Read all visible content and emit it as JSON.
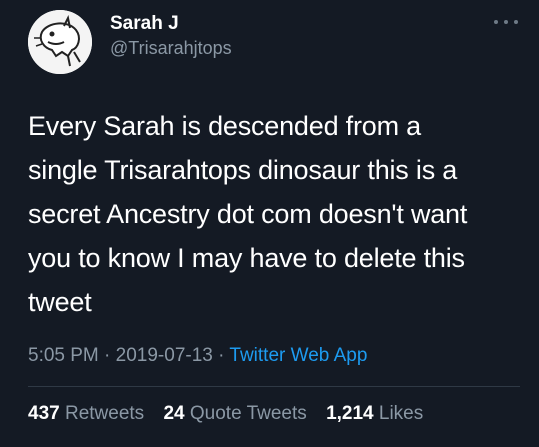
{
  "author": {
    "display_name": "Sarah J",
    "handle": "@Trisarahjtops",
    "avatar_icon": "dinosaur-sketch-avatar"
  },
  "more_icon": "ellipsis-icon",
  "tweet": {
    "text": "Every Sarah is descended from a\nsingle Trisarahtops dinosaur this is a\nsecret Ancestry dot com doesn't want\nyou to know I may have to delete this\ntweet",
    "time": "5:05 PM",
    "separator": "·",
    "date": "2019-07-13",
    "source": "Twitter Web App"
  },
  "stats": {
    "retweets_count": "437",
    "retweets_label": "Retweets",
    "quote_count": "24",
    "quote_label": "Quote Tweets",
    "likes_count": "1,214",
    "likes_label": "Likes"
  },
  "colors": {
    "background": "#141a24",
    "secondary_text": "#8b98a5",
    "link": "#1d9bf0"
  }
}
